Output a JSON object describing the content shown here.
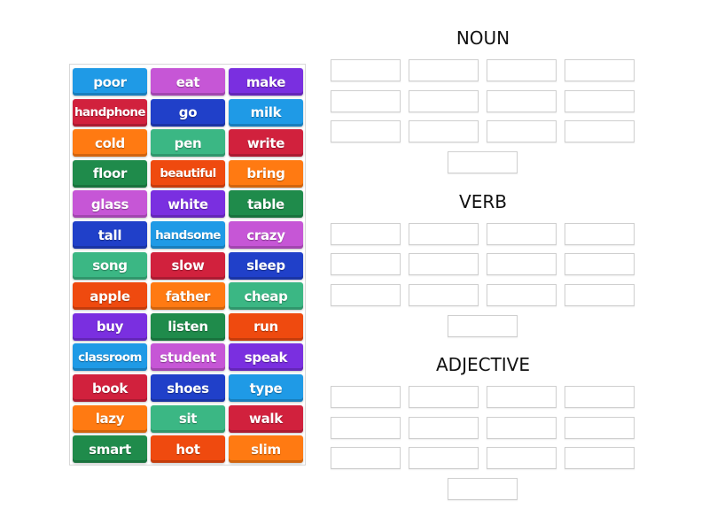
{
  "colors": {
    "blue": "#1f9ae6",
    "magenta": "#c656d6",
    "purple": "#7a2fe0",
    "red": "#d1213d",
    "navy": "#2040c9",
    "orange": "#ff7a12",
    "teal": "#3bb784",
    "green": "#1f8b4b",
    "redorange": "#ef4a0f"
  },
  "word_bank": [
    {
      "word": "poor",
      "color": "blue"
    },
    {
      "word": "eat",
      "color": "magenta"
    },
    {
      "word": "make",
      "color": "purple"
    },
    {
      "word": "handphone",
      "color": "red"
    },
    {
      "word": "go",
      "color": "navy"
    },
    {
      "word": "milk",
      "color": "blue"
    },
    {
      "word": "cold",
      "color": "orange"
    },
    {
      "word": "pen",
      "color": "teal"
    },
    {
      "word": "write",
      "color": "red"
    },
    {
      "word": "floor",
      "color": "green"
    },
    {
      "word": "beautiful",
      "color": "redorange"
    },
    {
      "word": "bring",
      "color": "orange"
    },
    {
      "word": "glass",
      "color": "magenta"
    },
    {
      "word": "white",
      "color": "purple"
    },
    {
      "word": "table",
      "color": "green"
    },
    {
      "word": "tall",
      "color": "navy"
    },
    {
      "word": "handsome",
      "color": "blue"
    },
    {
      "word": "crazy",
      "color": "magenta"
    },
    {
      "word": "song",
      "color": "teal"
    },
    {
      "word": "slow",
      "color": "red"
    },
    {
      "word": "sleep",
      "color": "navy"
    },
    {
      "word": "apple",
      "color": "redorange"
    },
    {
      "word": "father",
      "color": "orange"
    },
    {
      "word": "cheap",
      "color": "teal"
    },
    {
      "word": "buy",
      "color": "purple"
    },
    {
      "word": "listen",
      "color": "green"
    },
    {
      "word": "run",
      "color": "redorange"
    },
    {
      "word": "classroom",
      "color": "blue"
    },
    {
      "word": "student",
      "color": "magenta"
    },
    {
      "word": "speak",
      "color": "purple"
    },
    {
      "word": "book",
      "color": "red"
    },
    {
      "word": "shoes",
      "color": "navy"
    },
    {
      "word": "type",
      "color": "blue"
    },
    {
      "word": "lazy",
      "color": "orange"
    },
    {
      "word": "sit",
      "color": "teal"
    },
    {
      "word": "walk",
      "color": "red"
    },
    {
      "word": "smart",
      "color": "green"
    },
    {
      "word": "hot",
      "color": "redorange"
    },
    {
      "word": "slim",
      "color": "orange"
    }
  ],
  "groups": [
    {
      "title": "NOUN",
      "slots": 13
    },
    {
      "title": "VERB",
      "slots": 13
    },
    {
      "title": "ADJECTIVE",
      "slots": 13
    }
  ]
}
